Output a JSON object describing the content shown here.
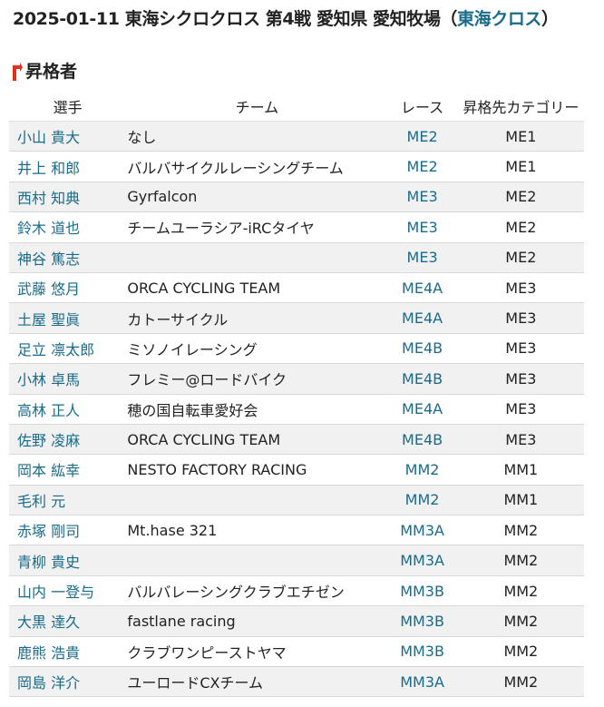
{
  "title": {
    "main": "2025-01-11 東海シクロクロス 第4戦 愛知県 愛知牧場",
    "paren_open": "（",
    "series": "東海クロス",
    "paren_close": "）"
  },
  "section": {
    "heading": "昇格者",
    "icon": "arrow-up-icon",
    "icon_color": "#e03020"
  },
  "colors": {
    "link": "#1a6b8a",
    "row_stripe": "#f1f1f1"
  },
  "table": {
    "headers": [
      "選手",
      "チーム",
      "レース",
      "昇格先カテゴリー"
    ],
    "rows": [
      {
        "rider": "小山 貴大",
        "team": "なし",
        "race": "ME2",
        "category": "ME1"
      },
      {
        "rider": "井上 和郎",
        "team": "バルバサイクルレーシングチーム",
        "race": "ME2",
        "category": "ME1"
      },
      {
        "rider": "西村 知典",
        "team": "Gyrfalcon",
        "race": "ME3",
        "category": "ME2"
      },
      {
        "rider": "鈴木 道也",
        "team": "チームユーラシア-iRCタイヤ",
        "race": "ME3",
        "category": "ME2"
      },
      {
        "rider": "神谷 篤志",
        "team": "",
        "race": "ME3",
        "category": "ME2"
      },
      {
        "rider": "武藤 悠月",
        "team": "ORCA CYCLING TEAM",
        "race": "ME4A",
        "category": "ME3"
      },
      {
        "rider": "土屋 聖眞",
        "team": "カトーサイクル",
        "race": "ME4A",
        "category": "ME3"
      },
      {
        "rider": "足立 凛太郎",
        "team": "ミソノイレーシング",
        "race": "ME4B",
        "category": "ME3"
      },
      {
        "rider": "小林 卓馬",
        "team": "フレミー@ロードバイク",
        "race": "ME4B",
        "category": "ME3"
      },
      {
        "rider": "高林 正人",
        "team": "穂の国自転車愛好会",
        "race": "ME4A",
        "category": "ME3"
      },
      {
        "rider": "佐野 凌麻",
        "team": "ORCA CYCLING TEAM",
        "race": "ME4B",
        "category": "ME3"
      },
      {
        "rider": "岡本 紘幸",
        "team": "NESTO FACTORY RACING",
        "race": "MM2",
        "category": "MM1"
      },
      {
        "rider": "毛利 元",
        "team": "",
        "race": "MM2",
        "category": "MM1"
      },
      {
        "rider": "赤塚 剛司",
        "team": "Mt.hase 321",
        "race": "MM3A",
        "category": "MM2"
      },
      {
        "rider": "青柳 貴史",
        "team": "",
        "race": "MM3A",
        "category": "MM2"
      },
      {
        "rider": "山内 一登与",
        "team": "バルバレーシングクラブエチゼン",
        "race": "MM3B",
        "category": "MM2"
      },
      {
        "rider": "大黒 達久",
        "team": "fastlane racing",
        "race": "MM3B",
        "category": "MM2"
      },
      {
        "rider": "鹿熊 浩貴",
        "team": "クラブワンピーストヤマ",
        "race": "MM3B",
        "category": "MM2"
      },
      {
        "rider": "岡島 洋介",
        "team": "ユーロードCXチーム",
        "race": "MM3A",
        "category": "MM2"
      }
    ]
  }
}
